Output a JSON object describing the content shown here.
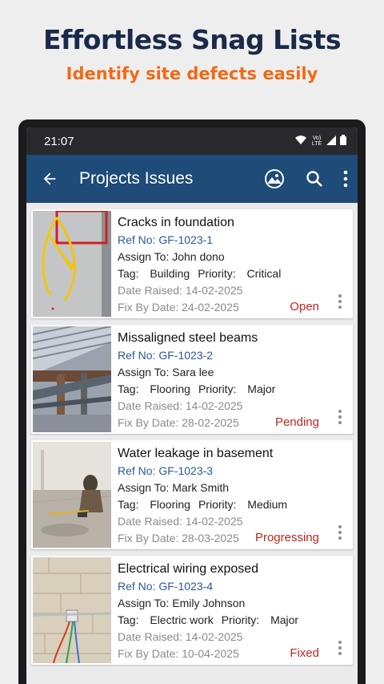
{
  "promo": {
    "title": "Effortless Snag Lists",
    "subtitle": "Identify site defects easily"
  },
  "statusbar": {
    "time": "21:07",
    "network_label": "Vo) LTE",
    "icons": [
      "wifi-icon",
      "signal-icon",
      "battery-icon"
    ]
  },
  "appbar": {
    "title": "Projects Issues",
    "back_icon": "arrow-left-icon",
    "actions": [
      "gallery-icon",
      "search-icon",
      "more-vertical-icon"
    ]
  },
  "labels": {
    "ref": "Ref No: ",
    "assign": "Assign To: ",
    "tag": "Tag: ",
    "priority": "Priority: ",
    "raised": "Date Raised: ",
    "fix": "Fix By Date: "
  },
  "colors": {
    "appbar": "#1e4b78",
    "promo_title": "#1a2a4a",
    "promo_subtitle": "#ef6a16",
    "ref_link": "#2a5a98",
    "status": "#c0261d"
  },
  "issues": [
    {
      "title": "Cracks in foundation",
      "ref": "GF-1023-1",
      "assignee": "John dono",
      "tag": "Building",
      "priority": "Critical",
      "date_raised": "14-02-2025",
      "fix_by": "24-02-2025",
      "status": "Open"
    },
    {
      "title": "Missaligned steel beams",
      "ref": "GF-1023-2",
      "assignee": "Sara lee",
      "tag": "Flooring",
      "priority": "Major",
      "date_raised": "14-02-2025",
      "fix_by": "28-02-2025",
      "status": "Pending"
    },
    {
      "title": "Water leakage in basement",
      "ref": "GF-1023-3",
      "assignee": "Mark Smith",
      "tag": "Flooring",
      "priority": "Medium",
      "date_raised": "14-02-2025",
      "fix_by": "28-03-2025",
      "status": "Progressing"
    },
    {
      "title": "Electrical wiring exposed",
      "ref": "GF-1023-4",
      "assignee": "Emily Johnson",
      "tag": "Electric work",
      "priority": "Major",
      "date_raised": "14-02-2025",
      "fix_by": "10-04-2025",
      "status": "Fixed"
    }
  ]
}
